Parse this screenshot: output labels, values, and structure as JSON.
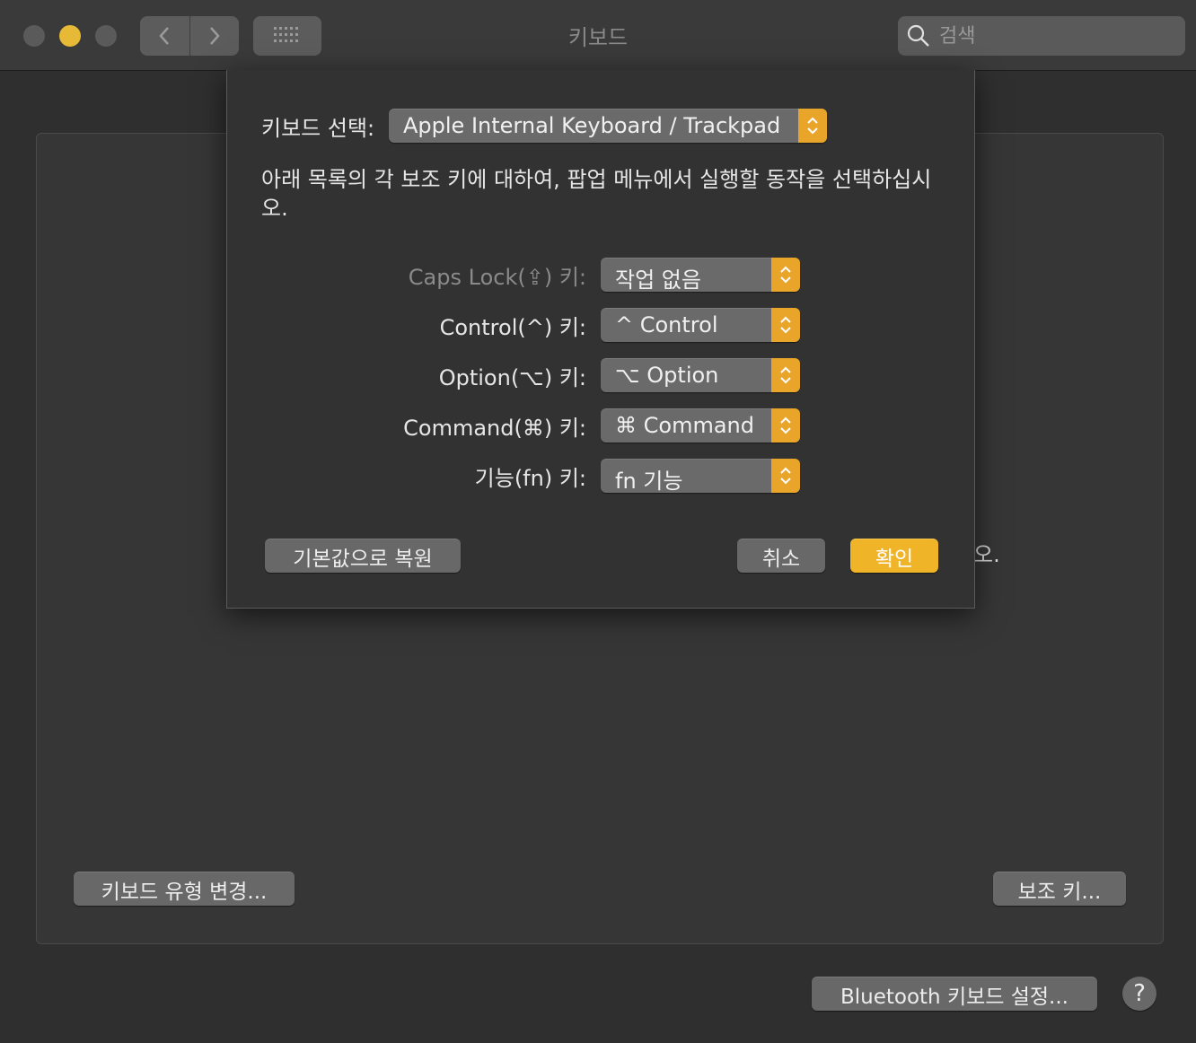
{
  "window": {
    "title": "키보드",
    "search_placeholder": "검색"
  },
  "pane": {
    "peek_text": "오.",
    "change_keyboard_type_button": "키보드 유형 변경...",
    "modifier_keys_button": "보조 키...",
    "bluetooth_button": "Bluetooth 키보드 설정...",
    "help_label": "?"
  },
  "sheet": {
    "keyboard_select_label": "키보드 선택:",
    "keyboard_select_value": "Apple Internal Keyboard / Trackpad",
    "description": "아래 목록의 각 보조 키에 대하여, 팝업 메뉴에서 실행할 동작을 선택하십시오.",
    "rows": [
      {
        "label": "Caps Lock(⇪) 키:",
        "value": "작업 없음"
      },
      {
        "label": "Control(^) 키:",
        "value": "^ Control"
      },
      {
        "label": "Option(⌥) 키:",
        "value": "⌥ Option"
      },
      {
        "label": "Command(⌘) 키:",
        "value": "⌘ Command"
      },
      {
        "label": "기능(fn) 키:",
        "value": "fn 기능"
      }
    ],
    "restore_defaults_button": "기본값으로 복원",
    "cancel_button": "취소",
    "ok_button": "확인"
  },
  "colors": {
    "accent": "#f0b429",
    "stepper": "#e9a52a",
    "minimize_light": "#e6b936"
  }
}
